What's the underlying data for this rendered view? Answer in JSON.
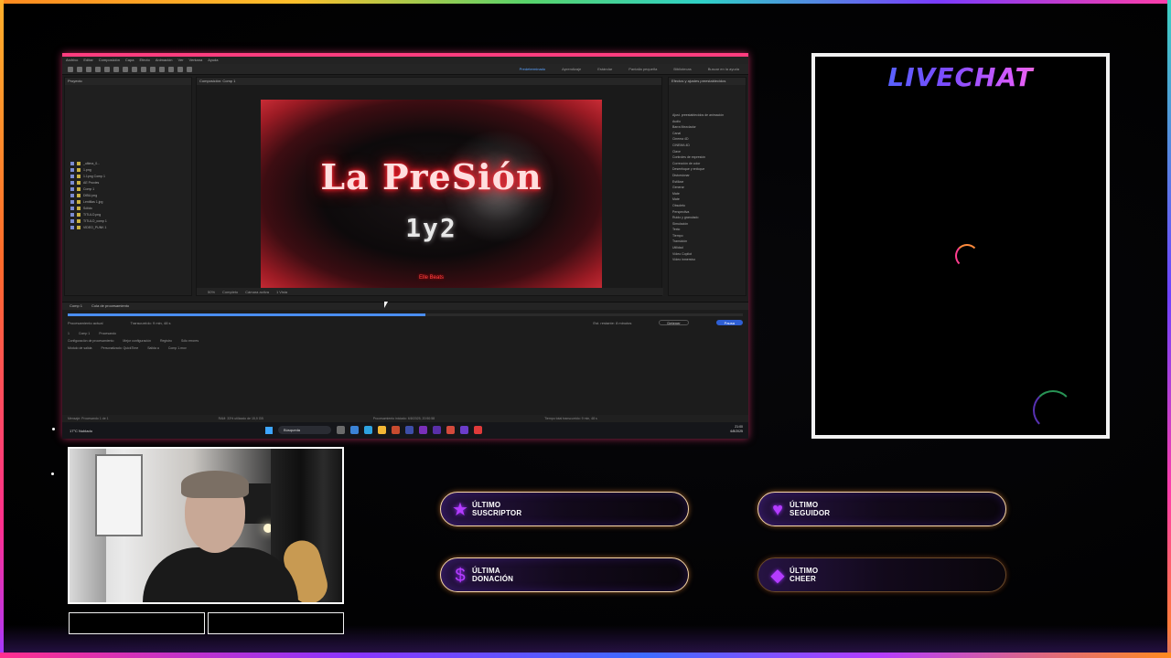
{
  "ae": {
    "menu": [
      "Archivo",
      "Editar",
      "Composición",
      "Capa",
      "Efecto",
      "Animación",
      "Ver",
      "Ventana",
      "Ayuda"
    ],
    "workspaces": [
      "Predeterminado",
      "Aprendizaje",
      "Estándar",
      "Pantalla pequeña",
      "Bibliotecas"
    ],
    "search_label": "Buscar en la ayuda",
    "project_tab": "Proyecto",
    "viewer_tab": "Composición: Comp 1",
    "files": [
      "_ultima_0...",
      "1.png",
      "1.1png Comp 1",
      "AE Proxies",
      "Comp 1",
      "DIBU.png",
      "Lentillas 1.jpg",
      "Sólido",
      "TITULO.png",
      "TITULO_comp 1",
      "VIDEO_PUNK 1"
    ],
    "comp": {
      "title": "La PreSión",
      "subtitle": "1y2",
      "credit": "Elle Beats"
    },
    "viewer_bar": [
      "50%",
      "Completo",
      "Cámara activa",
      "1 Vista"
    ],
    "effects_title": "Efectos y ajustes preestablecidos",
    "effects": [
      "Ajust. preestablecidos de animación",
      "Audio",
      "Barra Mezclador",
      "Canal",
      "Cinema 4D",
      "CINEMA 4D",
      "Clave",
      "Controles de expresión",
      "Corrección de color",
      "Desenfoque y enfoque",
      "Distorsionar",
      "Estilizar",
      "Generar",
      "Mate",
      "Mate",
      "Obsoleto",
      "Perspectiva",
      "Ruido y granulado",
      "Simulación",
      "Texto",
      "Tiempo",
      "Transición",
      "Utilidad",
      "Vídeo Copilot",
      "Vídeo inmersivo"
    ],
    "render": {
      "tabs": [
        "Comp 1",
        "Cola de procesamiento"
      ],
      "progress_pct": 53,
      "info_left": "Procesamiento actual",
      "info_mid": "Transcurrido: 9 min, 48 s",
      "info_right": "Est. restante: 8 minutos",
      "btn_stop": "Detener",
      "btn_pause": "Pausa",
      "row1": [
        "1",
        "Comp 1",
        "Procesando"
      ],
      "row2": [
        "Configuración de procesamiento",
        "Mejor configuración",
        "Registro",
        "Sólo errores"
      ],
      "row3": [
        "Módulo de salida",
        "Personalizado: QuickTime",
        "Salida a",
        "Comp 1.mov"
      ]
    },
    "status_left": "Mensaje: Procesando 1 de 1",
    "status_mid": "RAM: 33% utilizado de 15,9 GB",
    "status_right": "Procesamiento iniciado: 6/8/2025, 20:50:58",
    "status_far": "Tiempo total transcurrido: 9 min, 48 s",
    "taskbar": {
      "weather": "17°C Nublado",
      "search": "Búsqueda",
      "time": "21:00",
      "date": "6/8/2025",
      "lang": "ESP LAA"
    }
  },
  "livechat": {
    "title": "LIVECHAT"
  },
  "stats": [
    {
      "id": "subscriber",
      "line1": "ÚLTIMO",
      "line2": "SUSCRIPTOR",
      "icon": "star-icon",
      "glyph": "★"
    },
    {
      "id": "follower",
      "line1": "ÚLTIMO",
      "line2": "SEGUIDOR",
      "icon": "heart-icon",
      "glyph": "♥"
    },
    {
      "id": "donation",
      "line1": "ÚLTIMA",
      "line2": "DONACIÓN",
      "icon": "dollar-icon",
      "glyph": "$"
    },
    {
      "id": "cheer",
      "line1": "ÚLTIMO",
      "line2": "CHEER",
      "icon": "diamond-icon",
      "glyph": "◆"
    }
  ],
  "colors": {
    "accent_purple": "#b43cff",
    "accent_orange": "#ff8a1f",
    "accent_pink": "#ff3d7f",
    "ae_blue": "#2e5fd4"
  }
}
